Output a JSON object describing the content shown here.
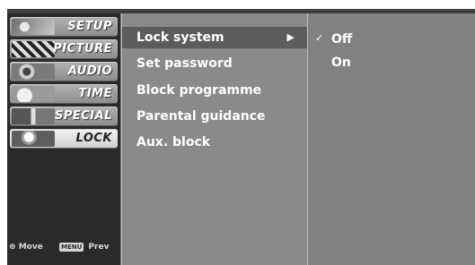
{
  "sidebar": {
    "categories": [
      {
        "label": "SETUP",
        "icon": "satellite-dish-icon",
        "active": false
      },
      {
        "label": "PICTURE",
        "icon": "film-clapper-icon",
        "active": false
      },
      {
        "label": "AUDIO",
        "icon": "speaker-icon",
        "active": false
      },
      {
        "label": "TIME",
        "icon": "clock-icon",
        "active": false
      },
      {
        "label": "SPECIAL",
        "icon": "gift-icon",
        "active": false
      },
      {
        "label": "LOCK",
        "icon": "padlock-icon",
        "active": true
      }
    ],
    "hints": {
      "move_icon": "dpad-icon",
      "move_label": "Move",
      "menu_key": "MENU",
      "prev_label": "Prev"
    }
  },
  "menu": {
    "items": [
      {
        "label": "Lock system",
        "selected": true,
        "arrow": "▶"
      },
      {
        "label": "Set password",
        "selected": false
      },
      {
        "label": "Block programme",
        "selected": false
      },
      {
        "label": "Parental guidance",
        "selected": false
      },
      {
        "label": "Aux. block",
        "selected": false
      }
    ]
  },
  "options": {
    "items": [
      {
        "label": "Off",
        "checked": true,
        "check_mark": "✓"
      },
      {
        "label": "On",
        "checked": false
      }
    ]
  },
  "colors": {
    "panel_dark": "#2a2a2a",
    "menu_bg": "#8a8a8a",
    "highlight": "#5c5c5c",
    "text": "#ffffff"
  }
}
